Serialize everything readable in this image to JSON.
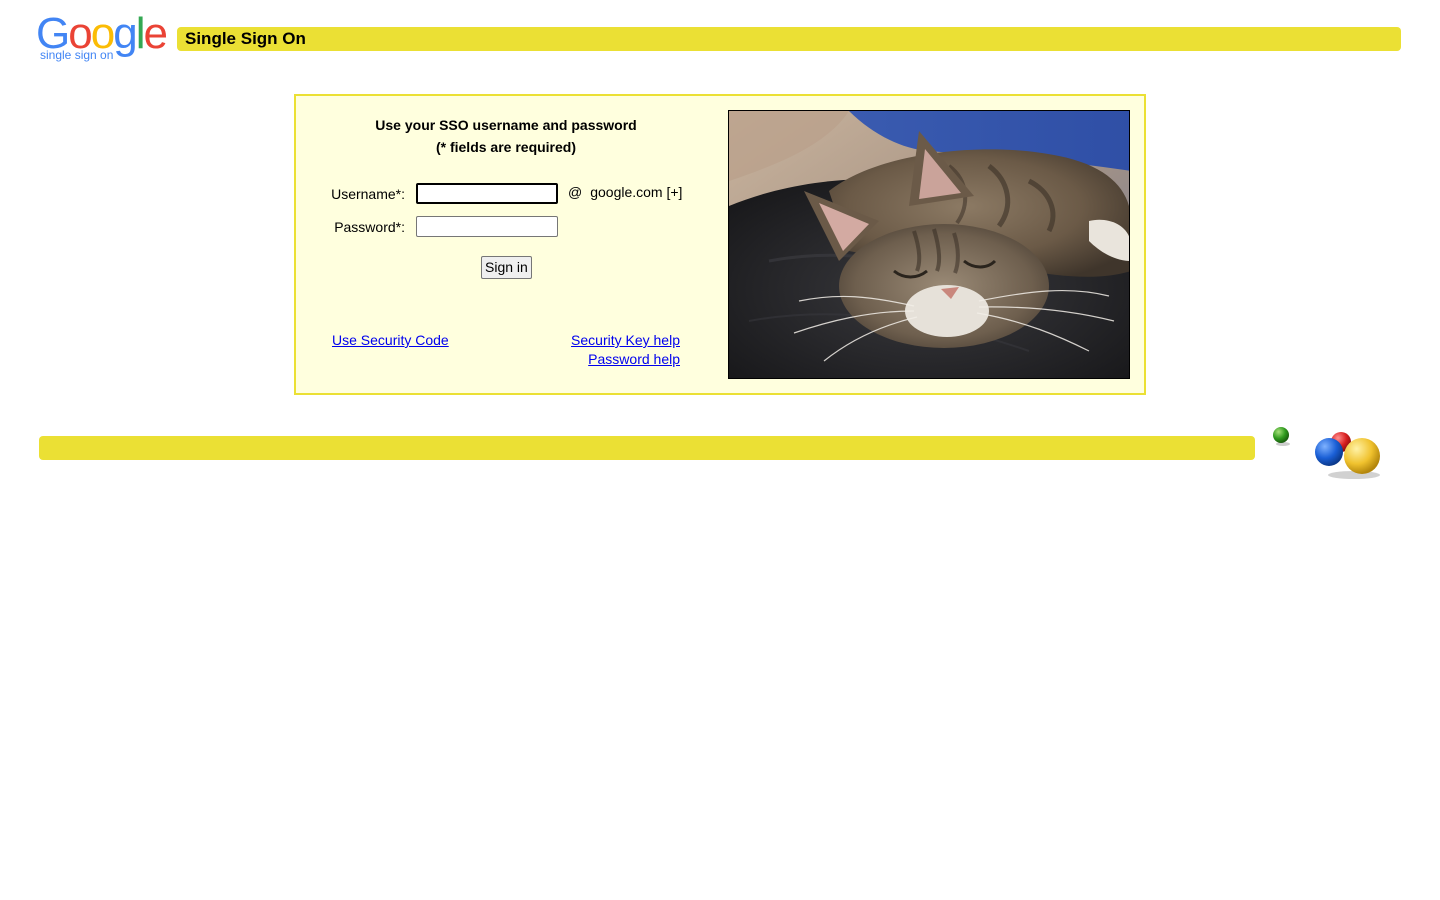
{
  "header": {
    "logo_text": "Google",
    "logo_subtitle": "single sign on",
    "title": "Single Sign On"
  },
  "login": {
    "heading_line1": "Use your SSO username and password",
    "heading_line2": "(* fields are required)",
    "username_label": "Username*:",
    "username_value": "",
    "password_label": "Password*:",
    "password_value": "",
    "at_symbol": "@",
    "domain": "google.com [+]",
    "signin_label": "Sign in",
    "links": {
      "security_code": "Use Security Code",
      "security_key_help": "Security Key help",
      "password_help": "Password help"
    }
  },
  "colors": {
    "bar_yellow": "#ebe034",
    "panel_background": "#ffffde",
    "link_blue": "#0000ee"
  },
  "icons": {
    "logo": "google-logo",
    "decoration": "google-balls-icon"
  }
}
